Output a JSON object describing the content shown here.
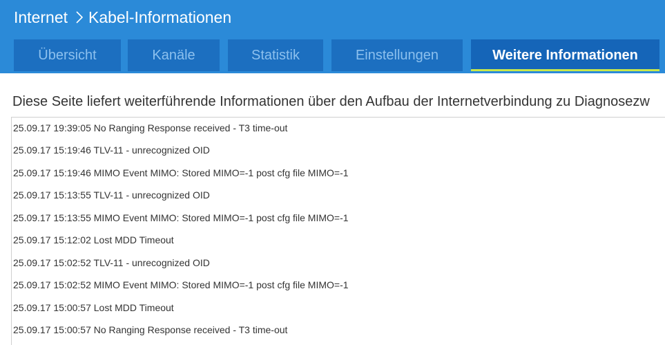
{
  "breadcrumb": {
    "parent": "Internet",
    "current": "Kabel-Informationen"
  },
  "tabs": [
    {
      "label": "Übersicht",
      "active": false
    },
    {
      "label": "Kanäle",
      "active": false
    },
    {
      "label": "Statistik",
      "active": false
    },
    {
      "label": "Einstellungen",
      "active": false
    },
    {
      "label": "Weitere Informationen",
      "active": true
    }
  ],
  "intro_text": "Diese Seite liefert weiterführende Informationen über den Aufbau der Internetverbindung zu Diagnosezw",
  "log_lines": [
    "25.09.17 19:39:05 No Ranging Response received - T3 time-out",
    "25.09.17 15:19:46 TLV-11 - unrecognized OID",
    "25.09.17 15:19:46 MIMO Event MIMO: Stored MIMO=-1 post cfg file MIMO=-1",
    "25.09.17 15:13:55 TLV-11 - unrecognized OID",
    "25.09.17 15:13:55 MIMO Event MIMO: Stored MIMO=-1 post cfg file MIMO=-1",
    "25.09.17 15:12:02 Lost MDD Timeout",
    "25.09.17 15:02:52 TLV-11 - unrecognized OID",
    "25.09.17 15:02:52 MIMO Event MIMO: Stored MIMO=-1 post cfg file MIMO=-1",
    "25.09.17 15:00:57 Lost MDD Timeout",
    "25.09.17 15:00:57 No Ranging Response received - T3 time-out"
  ],
  "colors": {
    "header": "#2b8ad8",
    "tab": "#1c6fc0",
    "tab_active": "#1565b8",
    "tab_active_underline": "#c9e84a",
    "tab_text": "#8cc0ee"
  },
  "icons": {
    "breadcrumb_separator": "chevron-right-icon"
  }
}
